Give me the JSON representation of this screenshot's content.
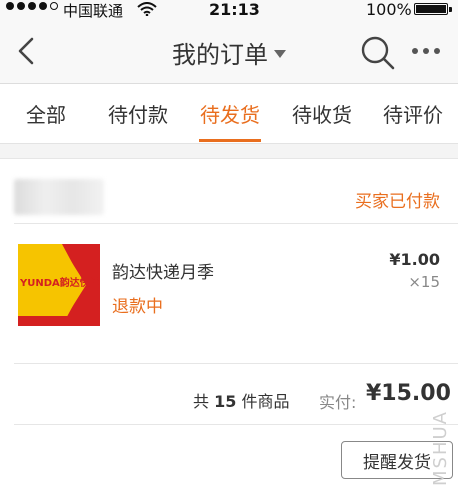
{
  "status_bar": {
    "carrier": "中国联通",
    "time": "21:13",
    "battery": "100%"
  },
  "nav": {
    "title": "我的订单"
  },
  "tabs": [
    {
      "label": "全部"
    },
    {
      "label": "待付款"
    },
    {
      "label": "待发货",
      "active": true
    },
    {
      "label": "待收货"
    },
    {
      "label": "待评价"
    }
  ],
  "order": {
    "status": "买家已付款",
    "product": {
      "thumbnail_text": "YUNDA韵达快递",
      "name": "韵达快递月季",
      "refund_status": "退款中",
      "price": "¥1.00",
      "quantity": "×15"
    },
    "summary": {
      "count_prefix": "共",
      "count": "15",
      "count_suffix": "件商品",
      "paid_label": "实付:",
      "paid_value": "¥15.00"
    },
    "remind_button": "提醒发货"
  },
  "watermark": "MSHUA",
  "colors": {
    "accent": "#e96e1e",
    "brand_yellow": "#f6c400",
    "brand_red": "#d42020"
  }
}
